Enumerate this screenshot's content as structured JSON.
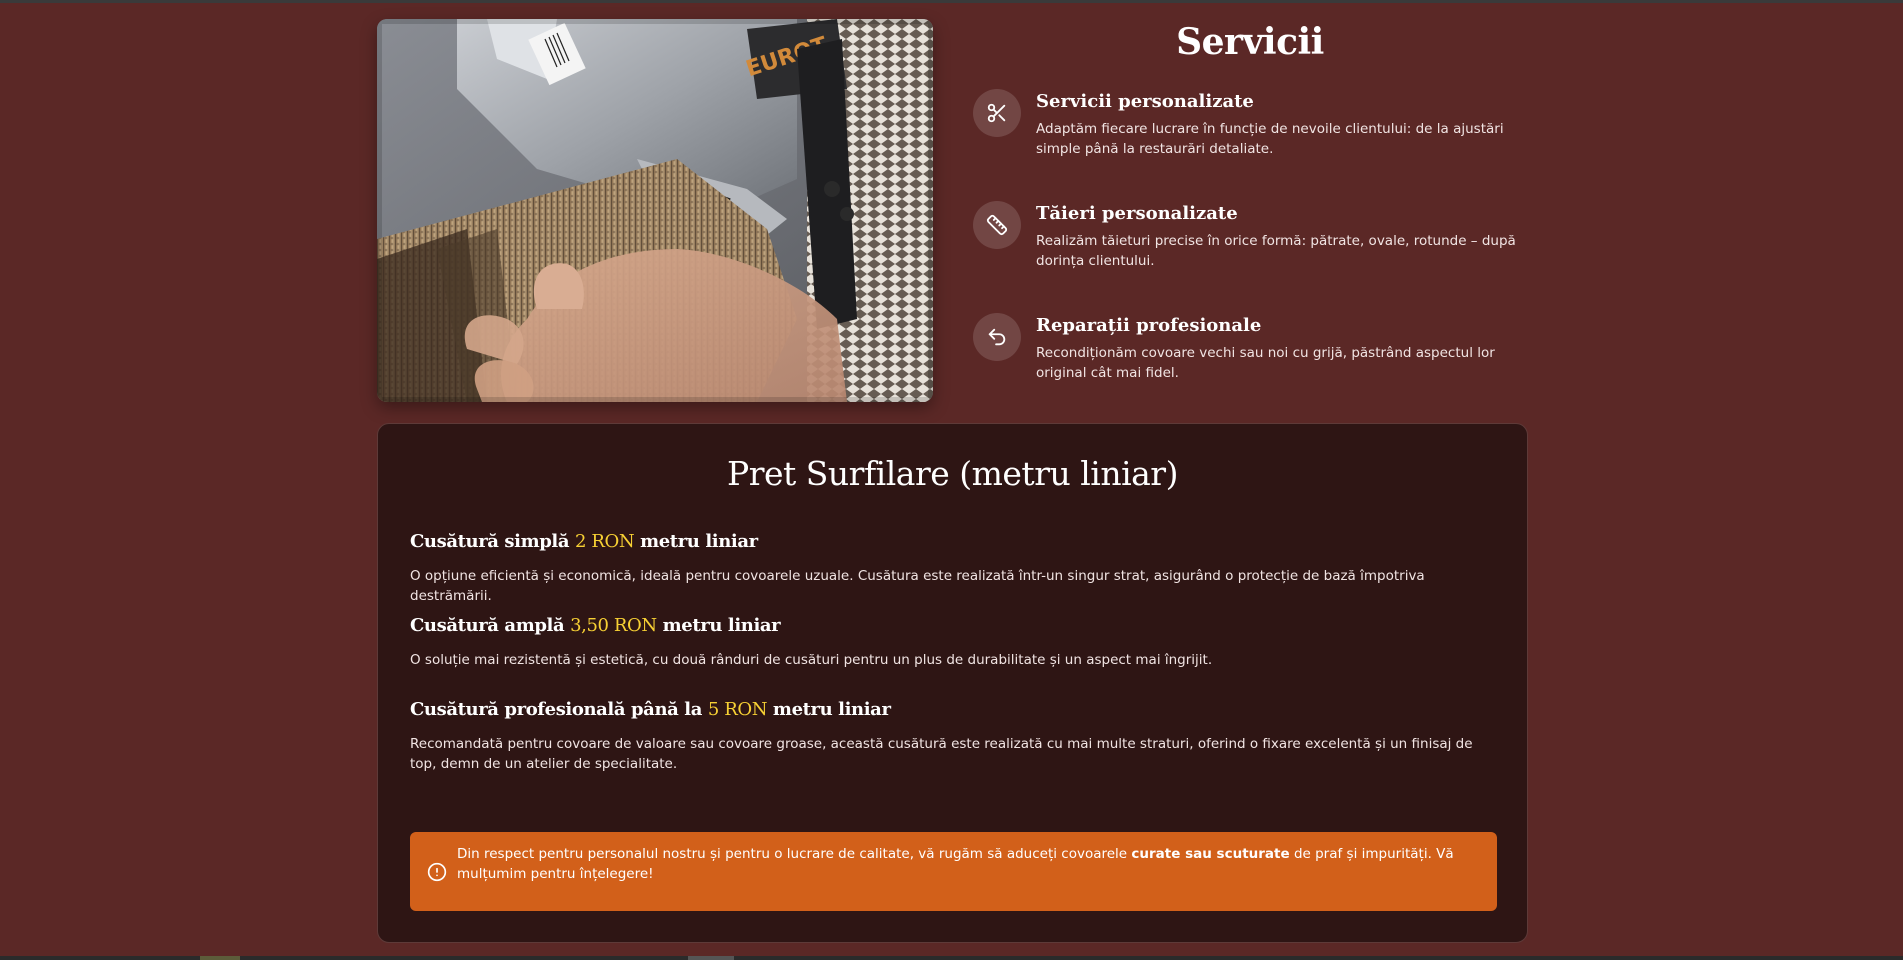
{
  "services": {
    "title": "Servicii",
    "items": [
      {
        "icon": "scissors-icon",
        "title": "Servicii personalizate",
        "description": "Adaptăm fiecare lucrare în funcție de nevoile clientului: de la ajustări simple până la restaurări detaliate."
      },
      {
        "icon": "ruler-icon",
        "title": "Tăieri personalizate",
        "description": "Realizăm tăieturi precise în orice formă: pătrate, ovale, rotunde – după dorința clientului."
      },
      {
        "icon": "undo-arrow-icon",
        "title": "Reparații profesionale",
        "description": "Recondiționăm covoare vechi sau noi cu grijă, păstrând aspectul lor original cât mai fidel."
      }
    ]
  },
  "hero_image": {
    "brand_text": "EUROT",
    "subject": "carpet-serging-machine-photo"
  },
  "pricing": {
    "title": "Pret Surfilare (metru liniar)",
    "tiers": [
      {
        "prefix": "Cusătură simplă ",
        "price": "2 RON",
        "suffix": " metru liniar",
        "description": "O opțiune eficientă și economică, ideală pentru covoarele uzuale. Cusătura este realizată într-un singur strat, asigurând o protecție de bază împotriva destrămării."
      },
      {
        "prefix": "Cusătură amplă ",
        "price": "3,50 RON",
        "suffix": " metru liniar",
        "description": "O soluție mai rezistentă și estetică, cu două rânduri de cusături pentru un plus de durabilitate și un aspect mai îngrijit."
      },
      {
        "prefix": "Cusătură profesională până la ",
        "price": "5 RON",
        "suffix": " metru liniar",
        "description": "Recomandată pentru covoare de valoare sau covoare groase, această cusătură este realizată cu mai multe straturi, oferind o fixare excelentă și un finisaj de top, demn de un atelier de specialitate."
      }
    ],
    "notice": {
      "icon": "alert-circle-icon",
      "before": "Din respect pentru personalul nostru și pentru o lucrare de calitate, vă rugăm să aduceți covoarele ",
      "bold": "curate sau scuturate",
      "after": " de praf și impurități. Vă mulțumim pentru înțelegere!"
    }
  },
  "colors": {
    "page_background": "#5b2826",
    "panel_background": "#2e1514",
    "price_accent": "#f7d034",
    "notice_background": "#d2601a"
  }
}
